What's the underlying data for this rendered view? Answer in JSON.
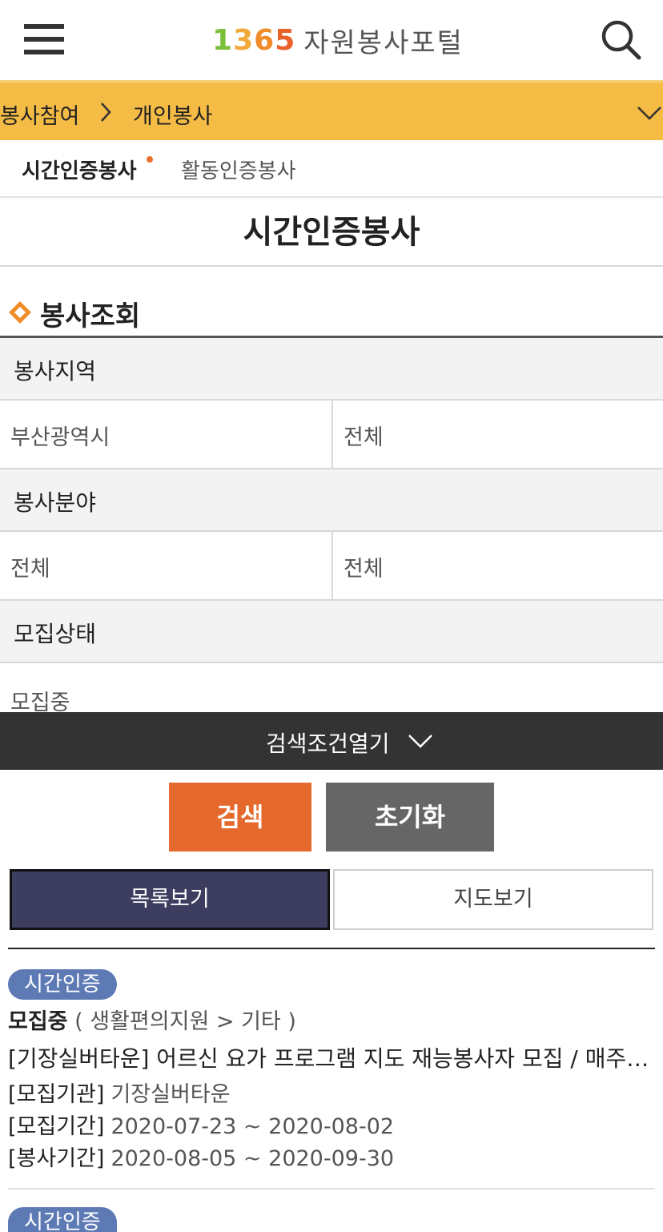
{
  "header": {
    "logo_number": [
      "1",
      "3",
      "6",
      "5"
    ],
    "logo_text": "자원봉사포털",
    "menu_icon": "hamburger-menu-icon",
    "search_icon": "search-icon"
  },
  "breadcrumb": {
    "items": [
      "봉사참여",
      "개인봉사"
    ],
    "toggle_icon": "chevron-down-icon"
  },
  "subtabs": {
    "items": [
      {
        "label": "시간인증봉사",
        "active": true
      },
      {
        "label": "활동인증봉사",
        "active": false
      }
    ]
  },
  "page": {
    "title": "시간인증봉사"
  },
  "search_section": {
    "title": "봉사조회",
    "region": {
      "label": "봉사지역",
      "values": [
        "부산광역시",
        "전체"
      ]
    },
    "field": {
      "label": "봉사분야",
      "values": [
        "전체",
        "전체"
      ]
    },
    "status": {
      "label": "모집상태",
      "value": "모집중"
    },
    "toggle_label": "검색조건열기"
  },
  "actions": {
    "search": "검색",
    "reset": "초기화"
  },
  "views": {
    "list": "목록보기",
    "map": "지도보기"
  },
  "results": [
    {
      "badge": "시간인증",
      "status": "모집중",
      "category": "( 생활편의지원  > 기타 )",
      "title": "[기장실버타운] 어르신 요가 프로그램 지도 재능봉사자 모집 / 매주 수요일",
      "org_label": "[모집기관]",
      "org": "기장실버타운",
      "recruit_label": "[모집기간]",
      "recruit_period": "2020-07-23 ~ 2020-08-02",
      "service_label": "[봉사기간]",
      "service_period": "2020-08-05 ~ 2020-09-30"
    },
    {
      "badge": "시간인증"
    }
  ],
  "colors": {
    "breadcrumb_bg": "#f4bb45",
    "search_button": "#e5692c",
    "reset_button": "#666666",
    "list_view_active": "#3d3d60",
    "badge": "#5d7ab5",
    "toggle_bar": "#333333"
  }
}
